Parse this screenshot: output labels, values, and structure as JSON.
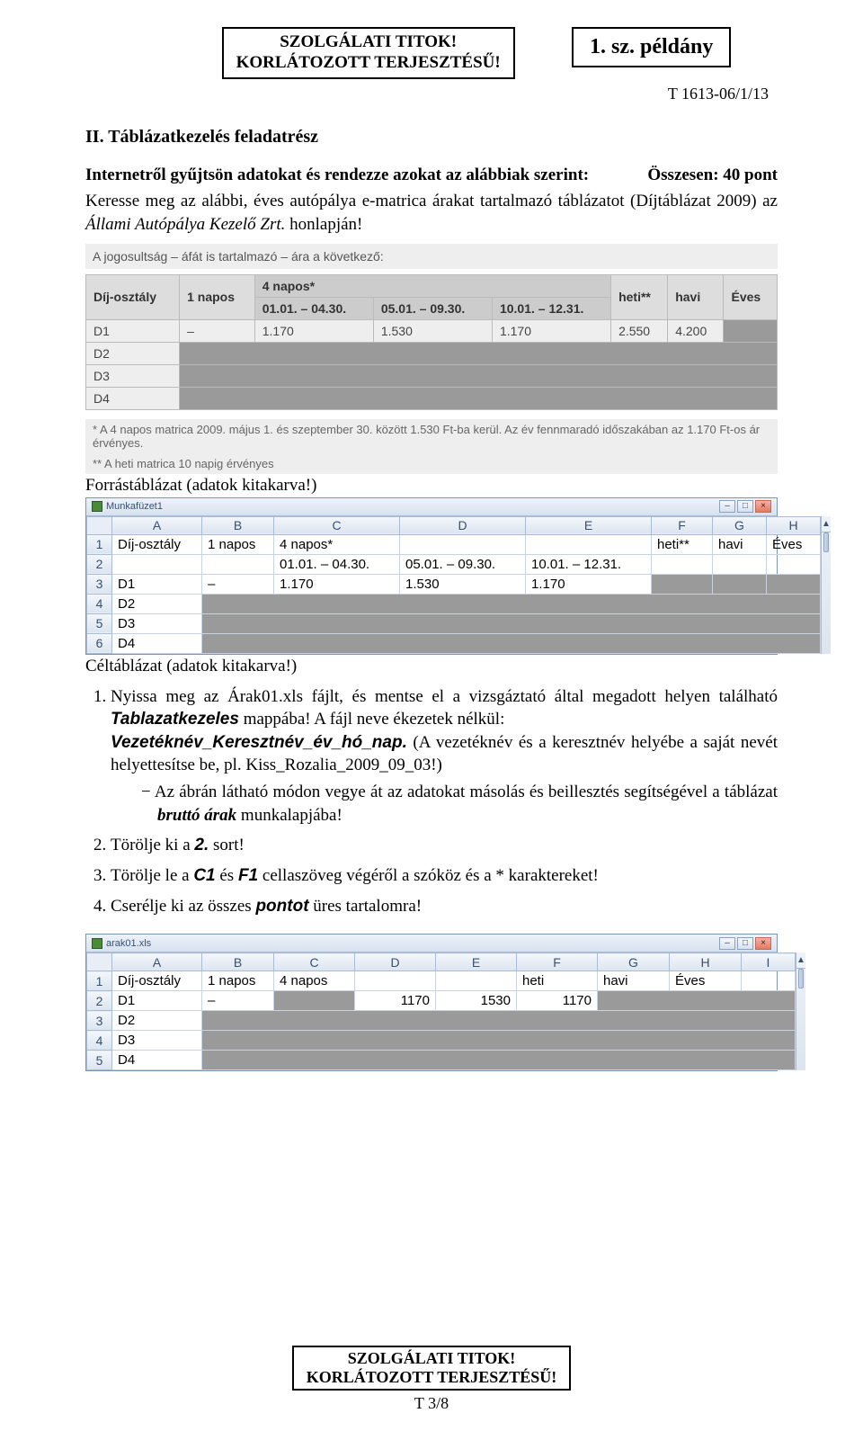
{
  "header": {
    "classification_line1": "SZOLGÁLATI TITOK!",
    "classification_line2": "KORLÁTOZOTT TERJESZTÉSŰ!",
    "copy_label": "1. sz. példány",
    "doc_code": "T 1613-06/1/13"
  },
  "section": {
    "title": "II. Táblázatkezelés feladatrész",
    "intro_line1_prefix": "Internetről gyűjtsön adatokat és rendezze azokat az alábbiak szerint:",
    "intro_line1_points": "Összesen: 40 pont",
    "intro_para": "Keresse meg az alábbi, éves autópálya e-matrica árakat tartalmazó táblázatot (Díjtáblázat 2009) az ",
    "intro_para_em": "Állami Autópálya Kezelő Zrt.",
    "intro_para_tail": " honlapján!"
  },
  "web": {
    "title_line": "A jogosultság – áfát is tartalmazó – ára a következő:",
    "headers": {
      "c1": "Díj-osztály",
      "c2": "1 napos",
      "c3top": "4 napos*",
      "c3a": "01.01. – 04.30.",
      "c3b": "05.01. – 09.30.",
      "c3c": "10.01. – 12.31.",
      "c4": "heti**",
      "c5": "havi",
      "c6": "Éves"
    },
    "rows": [
      {
        "a": "D1",
        "b": "–",
        "c": "1.170",
        "d": "1.530",
        "e": "1.170",
        "f": "2.550",
        "g": "4.200"
      },
      {
        "a": "D2"
      },
      {
        "a": "D3"
      },
      {
        "a": "D4"
      }
    ],
    "note1": "* A 4 napos matrica 2009. május 1. és szeptember 30. között 1.530 Ft-ba kerül. Az év fennmaradó időszakában az 1.170 Ft-os ár érvényes.",
    "note2": "** A heti matrica 10 napig érvényes"
  },
  "caption1": "Forrástáblázat (adatok kitakarva!)",
  "excel1": {
    "book": "Munkafüzet1",
    "cols": [
      "A",
      "B",
      "C",
      "D",
      "E",
      "F",
      "G",
      "H"
    ],
    "rows": [
      [
        "Díj-osztály",
        "1 napos",
        "4 napos*",
        "",
        "",
        "heti**",
        "havi",
        "Éves"
      ],
      [
        "",
        "",
        "01.01. – 04.30.",
        "05.01. – 09.30.",
        "10.01. – 12.31.",
        "",
        "",
        ""
      ],
      [
        "D1",
        "–",
        "1.170",
        "1.530",
        "1.170",
        "",
        "",
        ""
      ],
      [
        "D2",
        "",
        "",
        "",
        "",
        "",
        "",
        ""
      ],
      [
        "D3",
        "",
        "",
        "",
        "",
        "",
        "",
        ""
      ],
      [
        "D4",
        "",
        "",
        "",
        "",
        "",
        "",
        ""
      ]
    ]
  },
  "caption2": "Céltáblázat (adatok kitakarva!)",
  "steps": {
    "s1a": "Nyissa meg az Árak01.xls fájlt, és mentse el a vizsgáztató által megadott helyen található ",
    "s1b": "Tablazatkezeles",
    "s1c": " mappába! A fájl neve ékezetek nélkül: ",
    "s1d": "Vezetéknév_Keresztnév_év_hó_nap.",
    "s1e": " (A vezetéknév és a keresztnév helyébe a saját nevét helyettesítse be, pl. Kiss_Rozalia_2009_09_03!)",
    "s1dash": "−   Az ábrán látható módon vegye át az adatokat másolás és beillesztés segítségével a táblázat ",
    "s1dash_bi": "bruttó árak",
    "s1dash_tail": " munkalapjába!",
    "s2a": "Törölje ki a ",
    "s2b": "2.",
    "s2c": " sort!",
    "s3a": "Törölje le a ",
    "s3b": "C1",
    "s3mid": " és ",
    "s3c": "F1",
    "s3d": " cellaszöveg végéről a szóköz és a * karaktereket!",
    "s4a": "Cserélje ki az összes ",
    "s4b": "pontot",
    "s4c": " üres tartalomra!"
  },
  "excel2": {
    "book": "arak01.xls",
    "cols": [
      "A",
      "B",
      "C",
      "D",
      "E",
      "F",
      "G",
      "H",
      "I"
    ],
    "rows": [
      [
        "Díj-osztály",
        "1 napos",
        "4 napos",
        "",
        "",
        "heti",
        "havi",
        "Éves",
        ""
      ],
      [
        "D1",
        "–",
        "",
        "1170",
        "1530",
        "1170",
        "",
        "",
        ""
      ],
      [
        "D2",
        "",
        "",
        "",
        "",
        "",
        "",
        "",
        ""
      ],
      [
        "D3",
        "",
        "",
        "",
        "",
        "",
        "",
        "",
        ""
      ],
      [
        "D4",
        "",
        "",
        "",
        "",
        "",
        "",
        "",
        ""
      ]
    ]
  },
  "footer": {
    "line1": "SZOLGÁLATI TITOK!",
    "line2": "KORLÁTOZOTT TERJESZTÉSŰ!",
    "page": "T 3/8"
  }
}
